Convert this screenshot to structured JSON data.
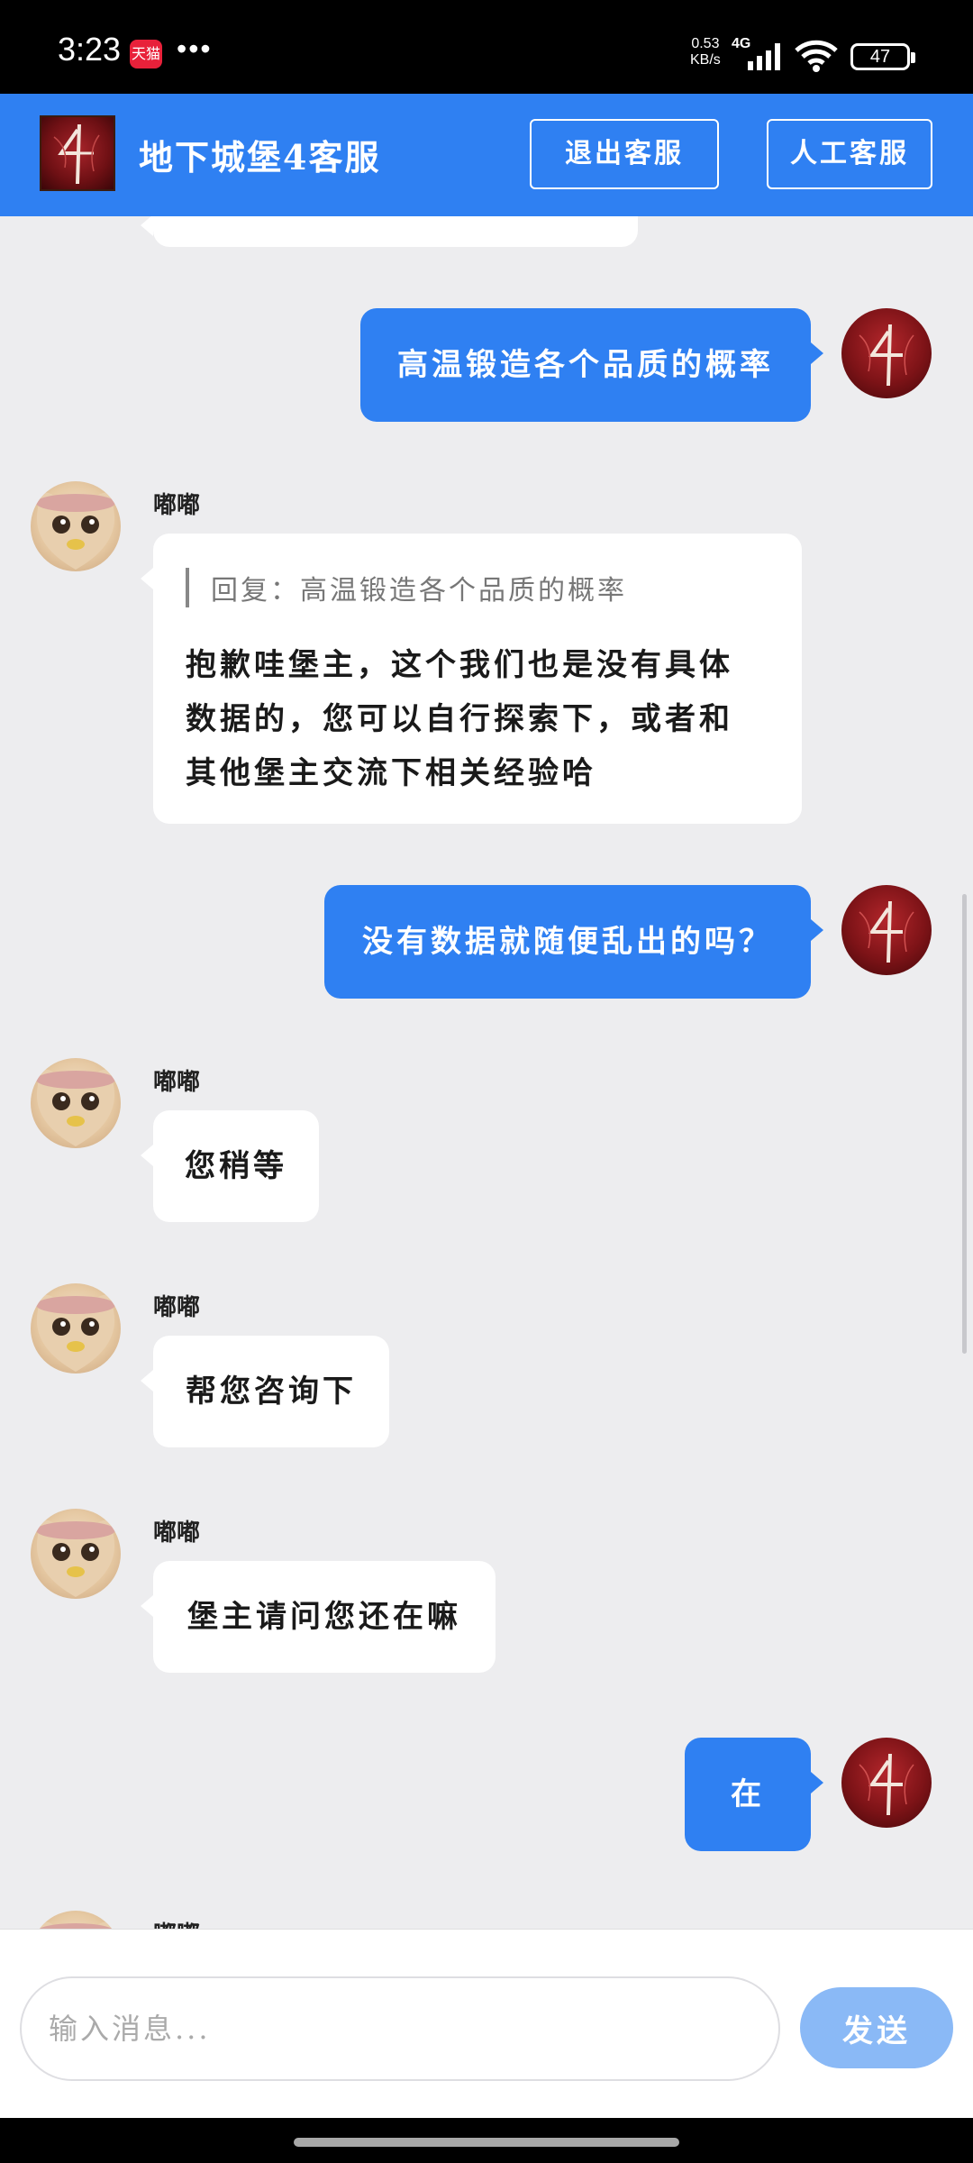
{
  "status_bar": {
    "time": "3:23",
    "app_badge": "天猫",
    "more": "•••",
    "net_speed_value": "0.53",
    "net_speed_unit": "KB/s",
    "network": "4G",
    "battery": "47"
  },
  "header": {
    "title": "地下城堡4客服",
    "exit_label": "退出客服",
    "human_label": "人工客服"
  },
  "messages": [
    {
      "type": "out",
      "text": "高温锻造各个品质的概率"
    },
    {
      "type": "in",
      "sender": "嘟嘟",
      "quote": "回复：高温锻造各个品质的概率",
      "lines": [
        "抱歉哇堡主，这个我们也是没有具体",
        "数据的，您可以自行探索下，或者和",
        "其他堡主交流下相关经验哈"
      ]
    },
    {
      "type": "out",
      "text": "没有数据就随便乱出的吗？"
    },
    {
      "type": "in",
      "sender": "嘟嘟",
      "text": "您稍等"
    },
    {
      "type": "in",
      "sender": "嘟嘟",
      "text": "帮您咨询下"
    },
    {
      "type": "in",
      "sender": "嘟嘟",
      "text": "堡主请问您还在嘛"
    },
    {
      "type": "out",
      "text": "在"
    },
    {
      "type": "in",
      "sender": "嘟嘟"
    }
  ],
  "input": {
    "placeholder": "输入消息...",
    "send_label": "发送"
  },
  "colors": {
    "accent": "#2f80f2",
    "send_disabled": "#8ab9f6",
    "chat_bg": "#ededef"
  }
}
